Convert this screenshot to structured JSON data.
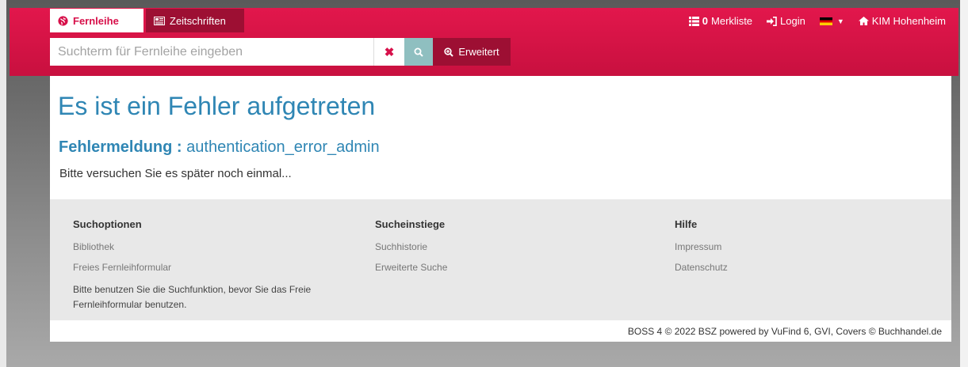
{
  "header": {
    "tabs": [
      {
        "label": "Fernleihe",
        "icon": "globe-icon",
        "active": true
      },
      {
        "label": "Zeitschriften",
        "icon": "newspaper-icon",
        "active": false
      }
    ],
    "nav": {
      "merkliste_count": "0",
      "merkliste_label": "Merkliste",
      "login_label": "Login",
      "language": "Deutsch",
      "library_label": "KIM Hohenheim"
    }
  },
  "search": {
    "placeholder": "Suchterm für Fernleihe eingeben",
    "value": "",
    "advanced_label": "Erweitert"
  },
  "main": {
    "title": "Es ist ein Fehler aufgetreten",
    "error_label": "Fehlermeldung :",
    "error_code": "authentication_error_admin",
    "message": "Bitte versuchen Sie es später noch einmal..."
  },
  "footer": {
    "columns": [
      {
        "heading": "Suchoptionen",
        "links": [
          "Bibliothek",
          "Freies Fernleihformular"
        ],
        "note": "Bitte benutzen Sie die Suchfunktion, bevor Sie das Freie Fernleihformular benutzen."
      },
      {
        "heading": "Sucheinstiege",
        "links": [
          "Suchhistorie",
          "Erweiterte Suche"
        ]
      },
      {
        "heading": "Hilfe",
        "links": [
          "Impressum",
          "Datenschutz"
        ]
      }
    ],
    "copyright": "BOSS 4 © 2022 BSZ powered by VuFind 6, GVI, Covers © Buchhandel.de"
  },
  "colors": {
    "brand": "#d7104a",
    "brand_dark": "#9d0f33",
    "link": "#2f86b4",
    "search_button": "#8fbfc0"
  }
}
